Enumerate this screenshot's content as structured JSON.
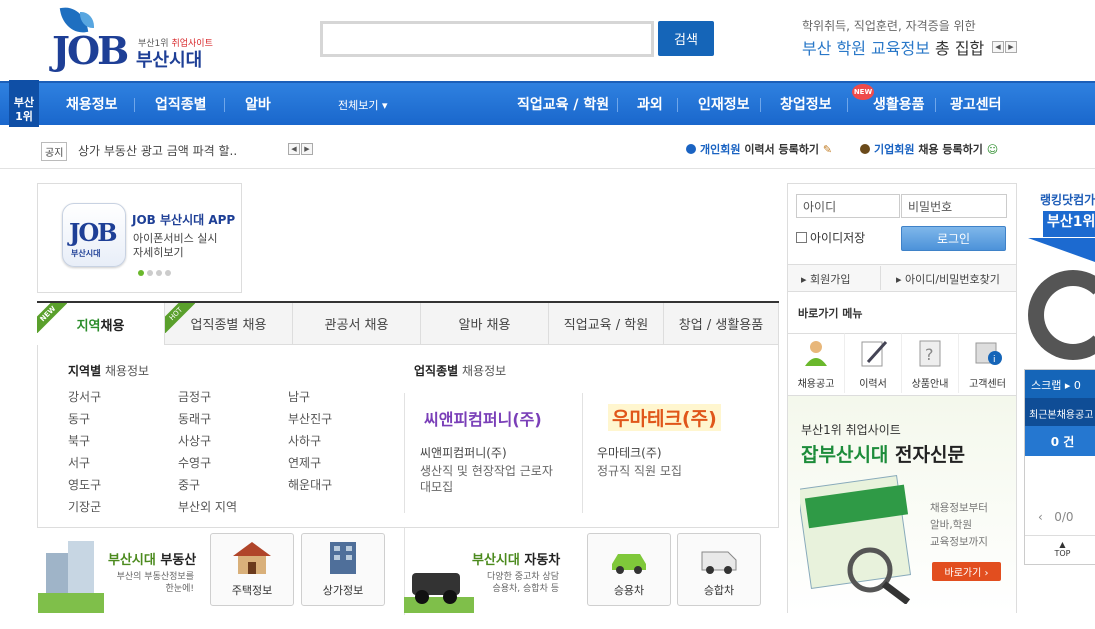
{
  "header": {
    "logo_sub": "부산1위",
    "logo_sub_red": "취업사이트",
    "logo_name": "부산시대",
    "logo_mark": "JOB",
    "search_placeholder": "",
    "search_button": "검색",
    "promo_line1": "학위취득, 직업훈련, 자격증을 위한",
    "promo_line2_blue": "부산 학원 교육정보",
    "promo_line2_rest": " 총 집합",
    "arrow_prev": "◀",
    "arrow_next": "▶"
  },
  "nav": {
    "badge": [
      "부산",
      "1위"
    ],
    "items": [
      "채용정보",
      "업직종별",
      "알바",
      "전체보기 ▾",
      "직업교육 / 학원",
      "과외",
      "인재정보",
      "창업정보",
      "생활용품",
      "광고센터"
    ],
    "new_badge": "NEW"
  },
  "notice": {
    "tag": "공지",
    "text": "상가 부동산 광고 금액 파격 할..",
    "personal_bold": "개인회원",
    "personal_rest": " 이력서 등록하기",
    "corp_bold": "기업회원",
    "corp_rest": " 채용 등록하기"
  },
  "app": {
    "icon_text": "JOB",
    "icon_sub": "부산시대",
    "title": "JOB 부산시대 APP",
    "desc1": "아이폰서비스 실시",
    "desc2": "자세히보기"
  },
  "tabs": [
    {
      "label_bold": "지역",
      "label_rest": " 채용",
      "ribbon": "NEW"
    },
    {
      "label_bold": "",
      "label_rest": "업직종별 채용",
      "ribbon": "HOT"
    },
    {
      "label_bold": "",
      "label_rest": "관공서 채용",
      "ribbon": ""
    },
    {
      "label_bold": "",
      "label_rest": "알바 채용",
      "ribbon": ""
    },
    {
      "label_bold": "",
      "label_rest": "직업교육 / 학원",
      "ribbon": ""
    },
    {
      "label_bold": "",
      "label_rest": "창업 / 생활용품",
      "ribbon": ""
    }
  ],
  "region": {
    "title_bold": "지역별",
    "title_rest": " 채용정보",
    "col1": [
      "강서구",
      "동구",
      "북구",
      "서구",
      "영도구",
      "기장군"
    ],
    "col2": [
      "금정구",
      "동래구",
      "사상구",
      "수영구",
      "중구",
      "부산외 지역"
    ],
    "col3": [
      "남구",
      "부산진구",
      "사하구",
      "연제구",
      "해운대구"
    ]
  },
  "jobtype": {
    "title_bold": "업직종별",
    "title_rest": " 채용정보",
    "companies": [
      {
        "logo": "씨앤피컴퍼니(주)",
        "name": "씨앤피컴퍼니(주)",
        "desc": [
          "생산직 및 현장작업 근로자",
          "대모집"
        ]
      },
      {
        "logo": "우마테크(주)",
        "name": "우마테크(주)",
        "desc": [
          "정규직 직원 모집"
        ]
      }
    ]
  },
  "banners": {
    "realestate_title": "부동산",
    "realestate_prefix": "부산시대 ",
    "realestate_sub": [
      "부산의 부동산정보를",
      "한눈에!"
    ],
    "realestate_buttons": [
      "주택정보",
      "상가정보"
    ],
    "car_title": "자동차",
    "car_prefix": "부산시대 ",
    "car_sub": [
      "다양한 중고차 상담",
      "승용차, 승합차 등"
    ],
    "car_buttons": [
      "승용차",
      "승합차"
    ]
  },
  "login": {
    "id_placeholder": "아이디",
    "pw_placeholder": "비밀번호",
    "save_id": "아이디저장",
    "login_button": "로그인",
    "signup": "회원가입",
    "find": "아이디/비밀번호찾기",
    "quick_title": "바로가기 메뉴",
    "quick": [
      "채용공고",
      "이력서",
      "상품안내",
      "고객센터"
    ]
  },
  "paper": {
    "line1": "부산1위 취업사이트",
    "line2_green": "잡부산시대",
    "line2_rest": " 전자신문",
    "desc": [
      "채용정보부터",
      "알바,학원",
      "교육정보까지"
    ],
    "button": "바로가기 ›"
  },
  "rail": {
    "rank_text": "랭킹닷컴가",
    "rank_num": "부산1위",
    "scrap": "스크랩 ▸ 0",
    "recent": "최근본채용공고",
    "recent_count": "0 건",
    "pager": "0/0",
    "top": "TOP"
  },
  "colors": {
    "primary": "#1a67cc",
    "green": "#1c8c3a",
    "red": "#d8282b"
  }
}
